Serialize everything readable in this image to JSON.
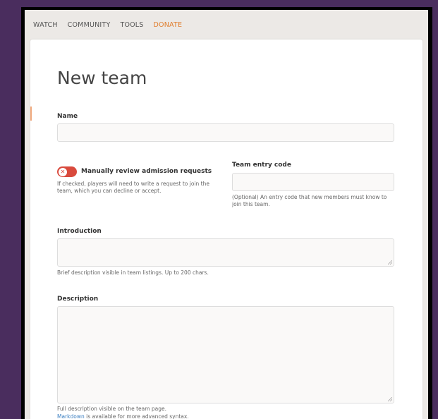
{
  "nav": {
    "items": [
      "WATCH",
      "COMMUNITY",
      "TOOLS"
    ],
    "donate": "DONATE"
  },
  "form": {
    "title": "New team",
    "name": {
      "label": "Name",
      "value": ""
    },
    "manual_review": {
      "label": "Manually review admission requests",
      "checked": false,
      "help": "If checked, players will need to write a request to join the team, which you can decline or accept."
    },
    "entry_code": {
      "label": "Team entry code",
      "value": "",
      "help": "(Optional) An entry code that new members must know to join this team."
    },
    "introduction": {
      "label": "Introduction",
      "value": "",
      "help": "Brief description visible in team listings. Up to 200 chars."
    },
    "description": {
      "label": "Description",
      "value": "",
      "help": "Full description visible on the team page.",
      "markdown_link": "Markdown",
      "markdown_text": " is available for more advanced syntax."
    }
  },
  "colors": {
    "background": "#4a2d5e",
    "accent": "#e07d2c",
    "toggle": "#d94a3d",
    "link": "#3a7ec0"
  }
}
